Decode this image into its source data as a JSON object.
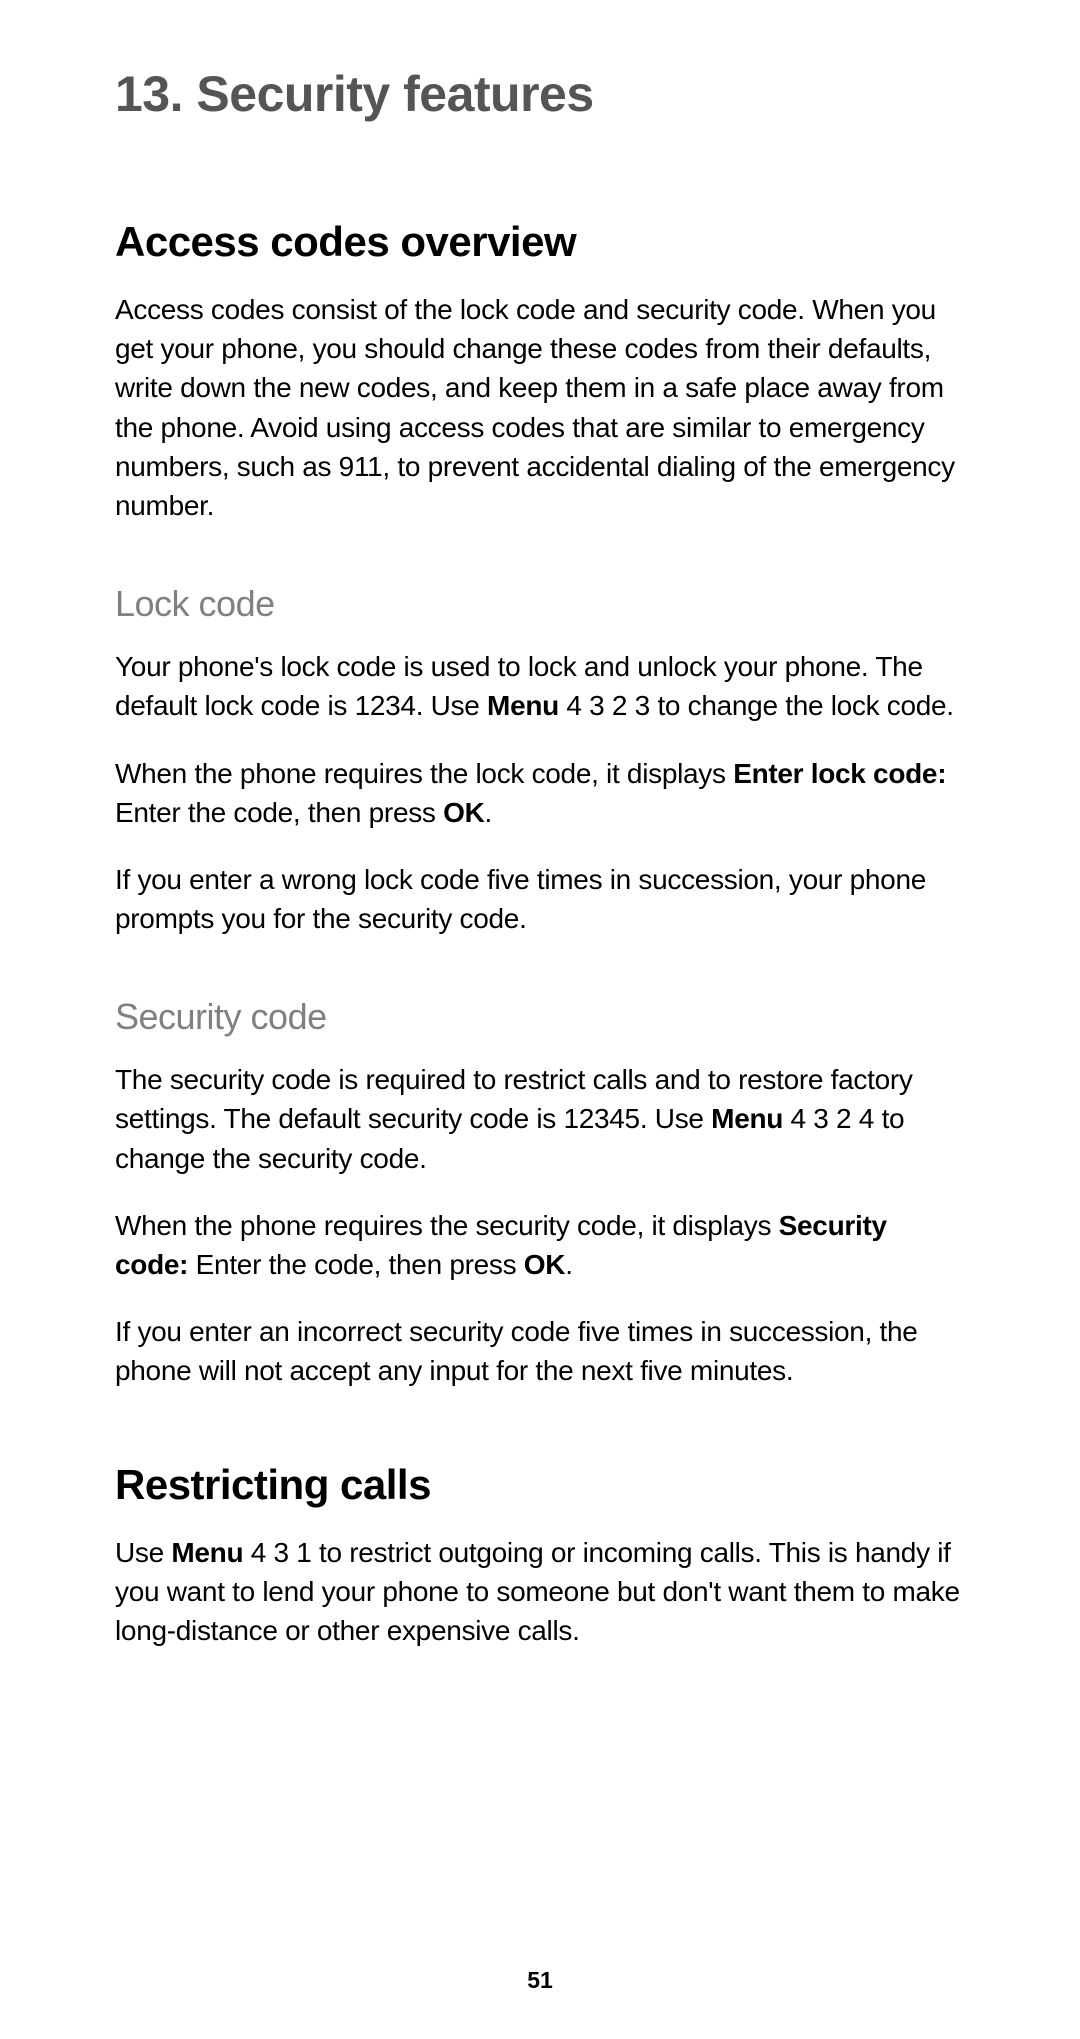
{
  "chapter": {
    "number": "13.",
    "title": "Security features"
  },
  "sections": {
    "accessCodes": {
      "title": "Access codes overview",
      "intro": "Access codes consist of the lock code and security code. When you get your phone, you should change these codes from their defaults, write down the new codes, and keep them in a safe place away from the phone. Avoid using access codes that are similar to emergency numbers, such as 911, to prevent accidental dialing of the emergency number.",
      "lockCode": {
        "title": "Lock code",
        "p1_a": "Your phone's lock code is used to lock and unlock your phone. The default lock code is 1234. Use ",
        "p1_b": "Menu",
        "p1_c": " 4 3 2 3 to change the lock code.",
        "p2_a": "When the phone requires the lock code, it displays ",
        "p2_b": "Enter lock code:",
        "p2_c": "  Enter the code, then press ",
        "p2_d": "OK",
        "p2_e": ".",
        "p3": "If you enter a wrong lock code five times in succession, your phone prompts you for the security code."
      },
      "securityCode": {
        "title": "Security code",
        "p1_a": "The security code is required to restrict calls and to restore factory settings. The default security code is 12345. Use ",
        "p1_b": "Menu",
        "p1_c": " 4 3 2 4 to change the security code.",
        "p2_a": "When the phone requires the security code, it displays ",
        "p2_b": "Security code:",
        "p2_c": "  Enter the code, then press ",
        "p2_d": "OK",
        "p2_e": ".",
        "p3": "If you enter an incorrect security code five times in succession, the phone will not accept any input for the next five minutes."
      }
    },
    "restricting": {
      "title": "Restricting calls",
      "p1_a": "Use ",
      "p1_b": "Menu",
      "p1_c": " 4 3 1 to restrict outgoing or incoming calls. This is handy if you want to lend your phone to someone but don't want them to make long-distance or other expensive calls."
    }
  },
  "pageNumber": "51"
}
